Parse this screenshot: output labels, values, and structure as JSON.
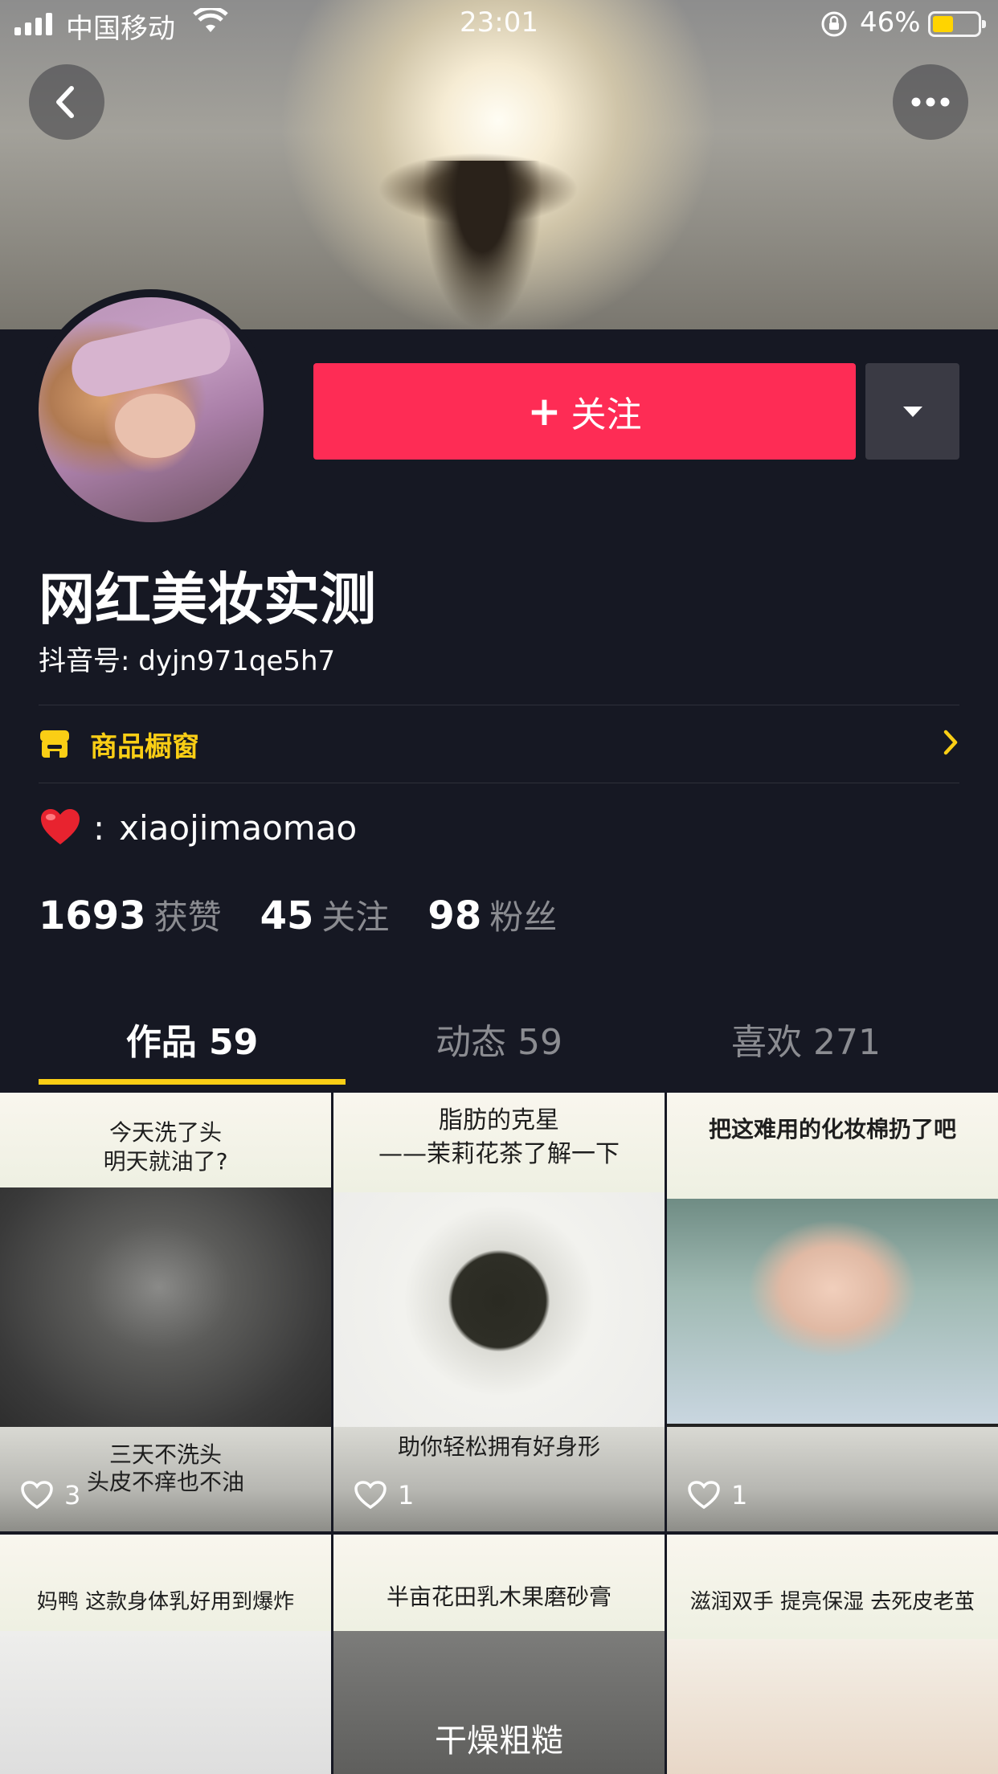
{
  "status_bar": {
    "carrier": "中国移动",
    "time": "23:01",
    "battery_percent": "46%",
    "battery_level": 0.46,
    "battery_color": "#ffd400"
  },
  "header": {
    "back_icon": "chevron-left-icon",
    "more_icon": "more-horizontal-icon"
  },
  "profile": {
    "follow_label": "关注",
    "follow_plus": "+",
    "follow_color": "#fe2c55",
    "name": "网红美妆实测",
    "douyin_id": "抖音号: dyjn971qe5h7",
    "shop_label": "商品橱窗",
    "shop_color": "#face15",
    "link_sep": ":",
    "link_text": "xiaojimaomao"
  },
  "stats": {
    "likes_num": "1693",
    "likes_label": "获赞",
    "following_num": "45",
    "following_label": "关注",
    "fans_num": "98",
    "fans_label": "粉丝"
  },
  "tabs": [
    {
      "label": "作品 59",
      "active": true
    },
    {
      "label": "动态 59",
      "active": false
    },
    {
      "label": "喜欢 271",
      "active": false
    }
  ],
  "videos": [
    {
      "top": "今天洗了头\n明天就油了?",
      "bottom": "三天不洗头\n头皮不痒也不油",
      "likes": "3"
    },
    {
      "top": "脂肪的克星\n——茉莉花茶了解一下",
      "bottom": "助你轻松拥有好身形",
      "likes": "1"
    },
    {
      "top": "把这难用的化妆棉扔了吧",
      "bottom": "",
      "likes": "1"
    },
    {
      "top": "妈鸭 这款身体乳好用到爆炸",
      "bottom": "",
      "likes": ""
    },
    {
      "top": "半亩花田乳木果磨砂膏",
      "bottom": "干燥粗糙",
      "likes": ""
    },
    {
      "top": "滋润双手 提亮保湿 去死皮老茧",
      "bottom": "",
      "likes": ""
    }
  ]
}
